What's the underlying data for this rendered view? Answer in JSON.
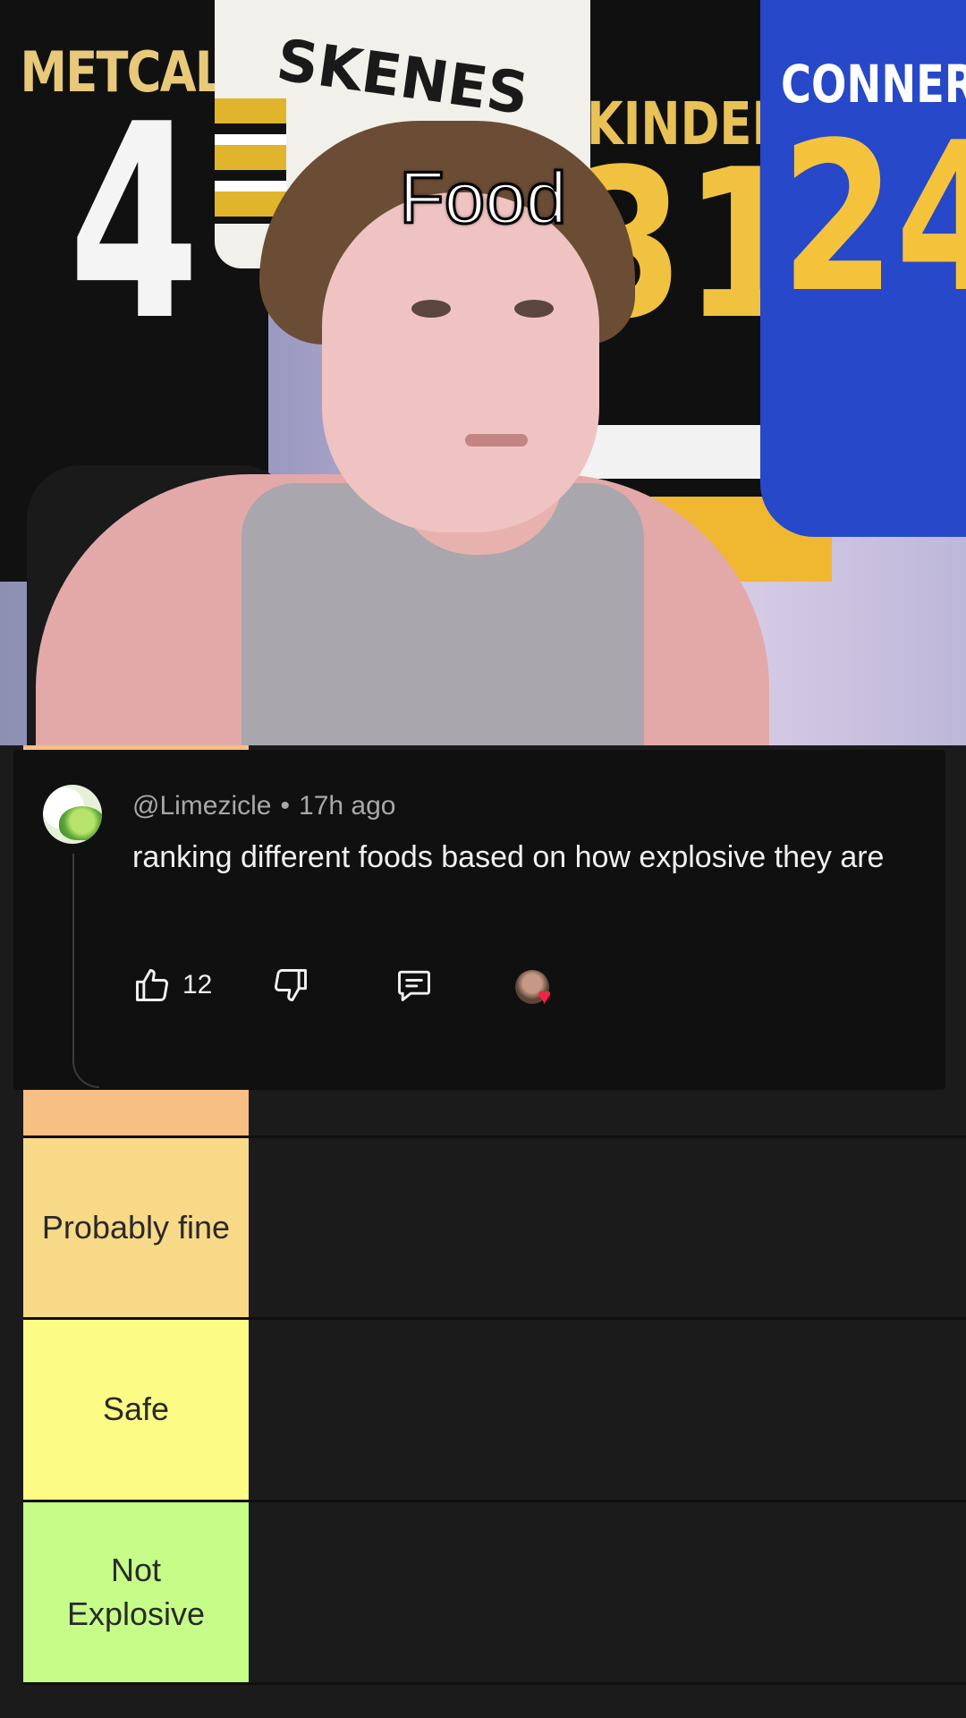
{
  "video": {
    "caption": "Food",
    "jerseys": [
      {
        "name": "METCALF",
        "number": "4"
      },
      {
        "name": "SKENES",
        "number": ""
      },
      {
        "name": "KINDEL",
        "number": "31"
      },
      {
        "name": "CONNER",
        "number": "24"
      }
    ]
  },
  "comment": {
    "username": "@Limezicle",
    "separator": "•",
    "time_ago": "17h ago",
    "text": "ranking different foods based on how explosive they are",
    "like_count": "12",
    "icons": {
      "like": "thumbs-up-icon",
      "dislike": "thumbs-down-icon",
      "reply": "comment-icon",
      "creator_heart": "creator-heart-icon"
    }
  },
  "tiers": [
    {
      "label": "",
      "color": "#f7bf83"
    },
    {
      "label": "Probably fine",
      "color": "#f8d987"
    },
    {
      "label": "Safe",
      "color": "#fcfb86"
    },
    {
      "label": "Not Explosive",
      "color": "#c6fd89"
    }
  ]
}
